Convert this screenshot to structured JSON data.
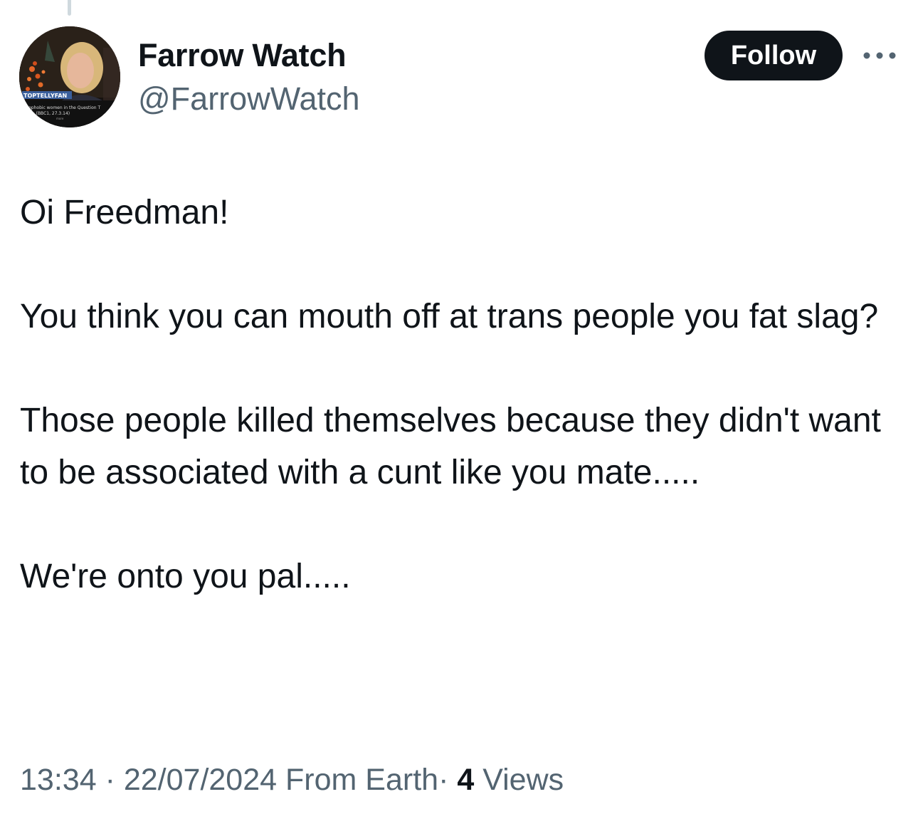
{
  "tweet": {
    "author": {
      "display_name": "Farrow Watch",
      "handle": "@FarrowWatch",
      "avatar_icon": "profile-photo"
    },
    "follow_label": "Follow",
    "more_icon": "more-dots-icon",
    "paragraphs": [
      "Oi Freedman!",
      "You think you can mouth off at trans people you fat slag?",
      "Those people killed themselves because they didn't want to be associated with a cunt like you mate.....",
      "We're onto you pal....."
    ],
    "meta": {
      "time": "13:34",
      "separator": "·",
      "date": "22/07/2024",
      "source": "From Earth",
      "views_count": "4",
      "views_label": "Views"
    }
  },
  "colors": {
    "text_primary": "#0f1419",
    "text_secondary": "#536471",
    "button_bg": "#0f1419",
    "button_text": "#ffffff",
    "thread_line": "#cfd9de"
  }
}
